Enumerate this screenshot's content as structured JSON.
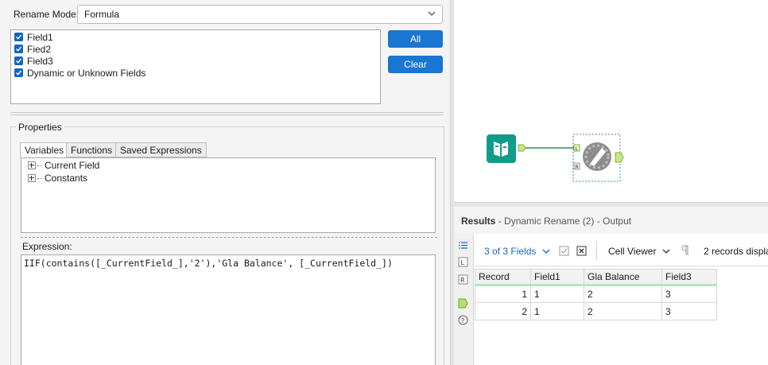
{
  "config": {
    "rename_mode_label": "Rename Mode:",
    "rename_mode_value": "Formula",
    "fields": [
      {
        "label": "Field1",
        "checked": true
      },
      {
        "label": "Fied2",
        "checked": true
      },
      {
        "label": "Field3",
        "checked": true
      },
      {
        "label": "Dynamic or Unknown Fields",
        "checked": true
      }
    ],
    "all_button": "All",
    "clear_button": "Clear",
    "properties_label": "Properties",
    "tabs": [
      "Variables",
      "Functions",
      "Saved Expressions"
    ],
    "tree_items": [
      "Current Field",
      "Constants"
    ],
    "expression_label": "Expression:",
    "expression": "IIF(contains([_CurrentField_],'2'),'Gla Balance', [_CurrentField_])"
  },
  "workflow": {
    "input_anchor_L": "L",
    "input_anchor_R": "R"
  },
  "results": {
    "title": "Results",
    "subtitle": " - Dynamic Rename (2) - Output",
    "fields_dropdown": "3 of 3 Fields",
    "cell_viewer": "Cell Viewer",
    "records_text": "2 records displa",
    "columns": [
      "Record",
      "Field1",
      "Gla Balance",
      "Field3"
    ],
    "rows": [
      [
        "1",
        "1",
        "2",
        "3"
      ],
      [
        "2",
        "1",
        "2",
        "3"
      ]
    ],
    "accent_color": "#1976d2",
    "header_underline_color": "#b9e3c1"
  }
}
